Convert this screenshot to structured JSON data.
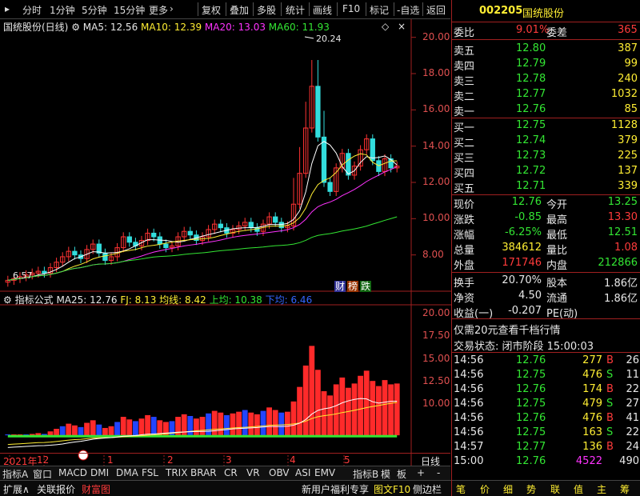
{
  "toolbar": {
    "items": [
      "分时",
      "1分钟",
      "5分钟",
      "15分钟",
      "更多",
      "复权",
      "叠加",
      "多股",
      "统计",
      "画线",
      "F10",
      "标记",
      "-自选",
      "返回"
    ],
    "more_arrow": "›"
  },
  "main_chart": {
    "title": "国统股份(日线)",
    "ma5": "MA5: 12.56",
    "ma10": "MA10: 12.39",
    "ma20": "MA20: 13.03",
    "ma60": "MA60: 11.93",
    "peak_label": "20.24",
    "low_label": "6.57",
    "y_ticks": [
      "20.00",
      "18.00",
      "16.00",
      "14.00",
      "12.00",
      "10.00",
      "8.00"
    ],
    "badges": [
      "财",
      "榜",
      "跌"
    ]
  },
  "indicator": {
    "title": "指标公式",
    "ma25": "MA25: 12.76",
    "fj": "FJ: 8.13",
    "jx": "均线: 8.42",
    "sj": "上均: 10.38",
    "xj": "下均: 6.46",
    "y_ticks": [
      "20.00",
      "17.50",
      "15.00",
      "12.50",
      "10.00"
    ]
  },
  "date_axis": {
    "labels": [
      "2021年",
      "12",
      "1",
      "2",
      "3",
      "4",
      "5"
    ],
    "right_label": "日线"
  },
  "tabs": [
    "指标A",
    "窗口",
    "MACD",
    "DMI",
    "DMA",
    "FSL",
    "TRIX",
    "BRAR",
    "CR",
    "VR",
    "OBV",
    "ASI",
    "EMV",
    "指标B",
    "模",
    "板",
    "+",
    "-"
  ],
  "statusbar": {
    "left": [
      "扩展∧",
      "关联报价",
      "财富图"
    ],
    "mid": [
      "新用户福利专享",
      "图文F10",
      "侧边栏"
    ],
    "right_tabs": [
      "笔",
      "价",
      "细",
      "势",
      "联",
      "值",
      "主",
      "筹"
    ]
  },
  "quote": {
    "code": "002205",
    "name": "国统股份",
    "weibi_label": "委比",
    "weibi": "9.01%",
    "weicha_label": "委差",
    "weicha": "365",
    "asks": [
      [
        "卖五",
        "12.80",
        "387"
      ],
      [
        "卖四",
        "12.79",
        "99"
      ],
      [
        "卖三",
        "12.78",
        "240"
      ],
      [
        "卖二",
        "12.77",
        "1032"
      ],
      [
        "卖一",
        "12.76",
        "85"
      ]
    ],
    "bids": [
      [
        "买一",
        "12.75",
        "1128"
      ],
      [
        "买二",
        "12.74",
        "379"
      ],
      [
        "买三",
        "12.73",
        "225"
      ],
      [
        "买四",
        "12.72",
        "137"
      ],
      [
        "买五",
        "12.71",
        "339"
      ]
    ],
    "stats": [
      [
        "现价",
        "12.76",
        "今开",
        "13.25"
      ],
      [
        "涨跌",
        "-0.85",
        "最高",
        "13.30"
      ],
      [
        "涨幅",
        "-6.25%",
        "最低",
        "12.51"
      ],
      [
        "总量",
        "384612",
        "量比",
        "1.08"
      ],
      [
        "外盘",
        "171746",
        "内盘",
        "212866"
      ]
    ],
    "stats2": [
      [
        "换手",
        "20.70%",
        "股本",
        "1.86亿"
      ],
      [
        "净资",
        "4.50",
        "流通",
        "1.86亿"
      ],
      [
        "收益(一)",
        "-0.207",
        "PE(动)",
        ""
      ]
    ],
    "promo": "仅需20元查看千档行情",
    "trade_status": "交易状态: 闭市阶段 15:00:03",
    "ticks": [
      [
        "14:56",
        "12.76",
        "277",
        "B",
        "26"
      ],
      [
        "14:56",
        "12.75",
        "476",
        "S",
        "11"
      ],
      [
        "14:56",
        "12.76",
        "174",
        "B",
        "22"
      ],
      [
        "14:56",
        "12.75",
        "479",
        "S",
        "27"
      ],
      [
        "14:56",
        "12.76",
        "476",
        "B",
        "41"
      ],
      [
        "14:56",
        "12.75",
        "163",
        "S",
        "22"
      ],
      [
        "14:57",
        "12.77",
        "136",
        "B",
        "24"
      ],
      [
        "15:00",
        "12.76",
        "4522",
        "",
        "490"
      ]
    ]
  },
  "chart_data": {
    "type": "candlestick",
    "title": "国统股份(日线)",
    "ylim": [
      6.0,
      21.0
    ],
    "closes": [
      6.6,
      6.7,
      6.8,
      6.9,
      7.0,
      7.1,
      7.0,
      7.3,
      7.6,
      7.9,
      8.2,
      8.0,
      7.8,
      8.3,
      8.6,
      8.1,
      7.7,
      7.9,
      8.4,
      9.0,
      8.7,
      8.5,
      8.8,
      9.2,
      9.0,
      8.6,
      8.4,
      8.5,
      9.0,
      9.3,
      9.1,
      8.8,
      9.0,
      9.4,
      9.7,
      9.5,
      9.2,
      9.4,
      9.6,
      9.8,
      9.5,
      9.3,
      9.7,
      10.1,
      9.8,
      9.5,
      9.6,
      10.8,
      12.5,
      15.0,
      17.3,
      14.5,
      12.0,
      11.5,
      12.8,
      13.6,
      12.4,
      12.9,
      13.8,
      14.4,
      13.2,
      12.6,
      13.3,
      12.8,
      12.9
    ]
  }
}
